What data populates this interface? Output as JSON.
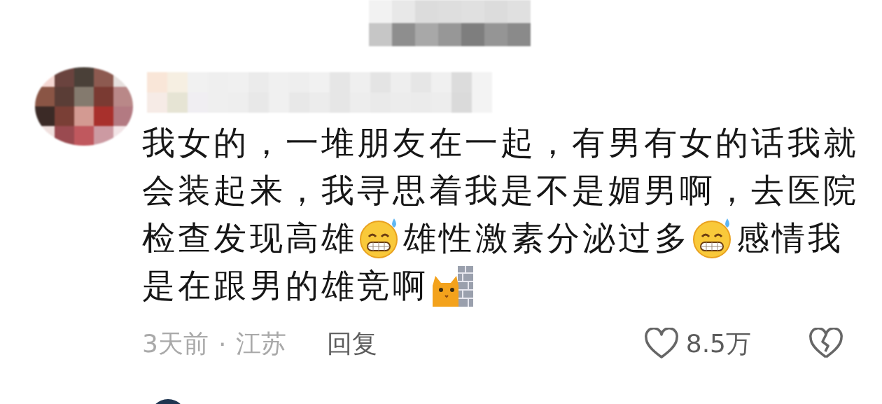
{
  "comment": {
    "lines": [
      [
        {
          "kind": "text",
          "text": "我女的，一堆朋友在一起，有男有女的话我就"
        }
      ],
      [
        {
          "kind": "text",
          "text": "会装起来，我寻思着我是不是媚男啊，去医院"
        }
      ],
      [
        {
          "kind": "text",
          "text": "检查发现高雄"
        },
        {
          "kind": "grin-sweat"
        },
        {
          "kind": "text",
          "text": "雄性激素分泌过多"
        },
        {
          "kind": "grin-sweat"
        },
        {
          "kind": "text",
          "text": "感情我"
        }
      ],
      [
        {
          "kind": "text",
          "text": "是在跟男的雄竞啊"
        },
        {
          "kind": "cat-wall"
        }
      ]
    ],
    "time": "3天前",
    "separator": "·",
    "location": "江苏",
    "reply": "回复",
    "likes": "8.5万"
  }
}
